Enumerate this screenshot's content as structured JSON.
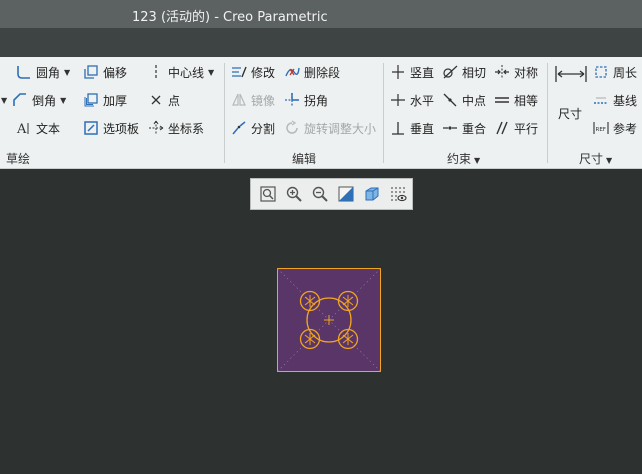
{
  "window": {
    "title": "123 (活动的) - Creo Parametric"
  },
  "ribbon": {
    "sketch_group": {
      "label": "草绘",
      "fillet": "圆角",
      "chamfer": "倒角",
      "text": "文本",
      "offset": "偏移",
      "thicken": "加厚",
      "palette": "选项板",
      "centerline": "中心线",
      "point": "点",
      "coord_system": "坐标系"
    },
    "edit_group": {
      "label": "编辑",
      "modify": "修改",
      "delete_segment": "删除段",
      "mirror": "镜像",
      "corner": "拐角",
      "divide": "分割",
      "rotate_resize": "旋转调整大小"
    },
    "constrain_group": {
      "label": "约束",
      "vertical": "竖直",
      "tangent": "相切",
      "symmetric": "对称",
      "horizontal": "水平",
      "midpoint": "中点",
      "equal": "相等",
      "perpendicular": "垂直",
      "coincident": "重合",
      "parallel": "平行"
    },
    "dimension_group": {
      "label": "尺寸",
      "dimension": "尺寸",
      "perimeter": "周长",
      "baseline": "基线",
      "reference": "参考"
    }
  },
  "colors": {
    "sketch_fill": "#5a3568",
    "sketch_stroke": "#f2a51f",
    "canvas_bg": "#2d3130",
    "ribbon_bg": "#eef1f1",
    "accent_blue": "#2e6fb6"
  },
  "view_toolbar": {
    "icons": [
      "zoom-fit-icon",
      "zoom-in-icon",
      "zoom-out-icon",
      "repaint-icon",
      "display-style-icon",
      "sketch-display-icon"
    ]
  }
}
